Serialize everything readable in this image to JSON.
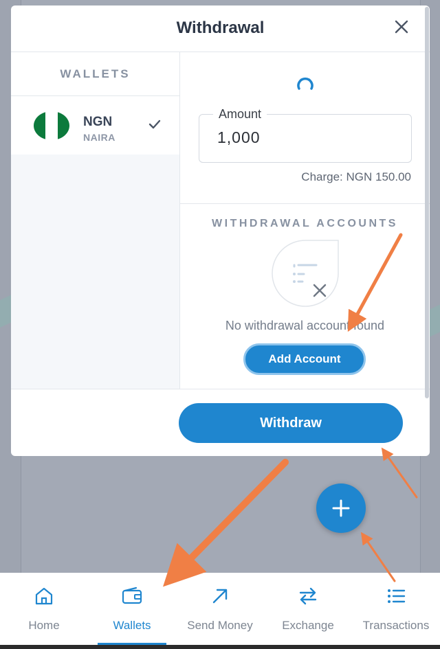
{
  "modal": {
    "title": "Withdrawal",
    "close_icon": "close-icon"
  },
  "wallets": {
    "heading": "WALLETS",
    "items": [
      {
        "code": "NGN",
        "name": "NAIRA",
        "flag_icon": "nigeria-flag-icon",
        "selected": true
      }
    ]
  },
  "amount": {
    "label": "Amount",
    "value": "1,000",
    "charge": "Charge: NGN 150.00"
  },
  "withdrawal_accounts": {
    "heading": "WITHDRAWAL ACCOUNTS",
    "empty_text": "No withdrawal account found",
    "add_button": "Add Account"
  },
  "footer": {
    "withdraw_button": "Withdraw"
  },
  "fab": {
    "icon": "plus-icon"
  },
  "bottom_nav": {
    "items": [
      {
        "label": "Home",
        "icon": "home-icon",
        "active": false
      },
      {
        "label": "Wallets",
        "icon": "wallet-icon",
        "active": true
      },
      {
        "label": "Send Money",
        "icon": "arrow-up-right-icon",
        "active": false
      },
      {
        "label": "Exchange",
        "icon": "exchange-icon",
        "active": false
      },
      {
        "label": "Transactions",
        "icon": "list-icon",
        "active": false
      }
    ]
  },
  "colors": {
    "accent": "#1f86cf",
    "flag_green": "#0c7a3c",
    "annotation_arrow": "#f07f45"
  }
}
